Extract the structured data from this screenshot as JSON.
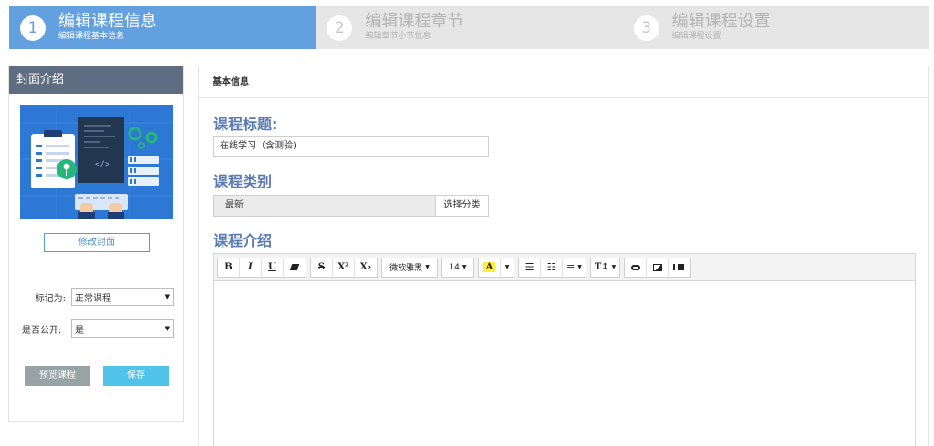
{
  "steps": [
    {
      "num": "1",
      "title": "编辑课程信息",
      "subtitle": "编辑课程基本信息"
    },
    {
      "num": "2",
      "title": "编辑课程章节",
      "subtitle": "编辑章节小节信息"
    },
    {
      "num": "3",
      "title": "编辑课程设置",
      "subtitle": "编辑课程设置"
    }
  ],
  "sidebar": {
    "title": "封面介绍",
    "change_cover_label": "修改封面",
    "mark_label": "标记为:",
    "mark_value": "正常课程",
    "public_label": "是否公开:",
    "public_value": "是",
    "preview_label": "预览课程",
    "save_label": "保存"
  },
  "main": {
    "header": "基本信息",
    "title_label": "课程标题:",
    "title_value": "在线学习（含测验)",
    "category_label": "课程类别",
    "category_value": "最新",
    "category_button": "选择分类",
    "intro_label": "课程介绍"
  },
  "editor": {
    "bold": "B",
    "italic": "I",
    "underline": "U",
    "strike": "S",
    "superscript": "X²",
    "subscript": "X₂",
    "font_family": "微软雅黑",
    "font_size": "14",
    "font_color": "A",
    "text_style": "T↕"
  },
  "colors": {
    "active_step": "#62a0e0",
    "inactive_step": "#e6e6e6",
    "sidebar_header": "#5f6d83",
    "section_label": "#5a7bb4",
    "save_button": "#4fc3e8",
    "preview_button": "#97a3a4",
    "cover_bg": "#2c78d4"
  }
}
